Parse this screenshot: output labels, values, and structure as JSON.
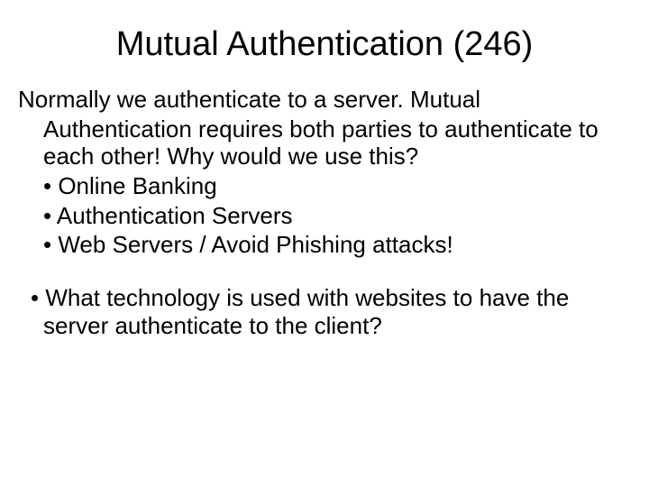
{
  "title": "Mutual Authentication (246)",
  "intro_line1": "Normally we authenticate to a server. Mutual",
  "intro_line2": "Authentication requires both parties to authenticate to each other! Why would we use this?",
  "bullets": {
    "b1": "Online Banking",
    "b2": "Authentication Servers",
    "b3": "Web Servers / Avoid Phishing attacks!"
  },
  "question": "• What technology is used with websites to have the server authenticate to the client?"
}
